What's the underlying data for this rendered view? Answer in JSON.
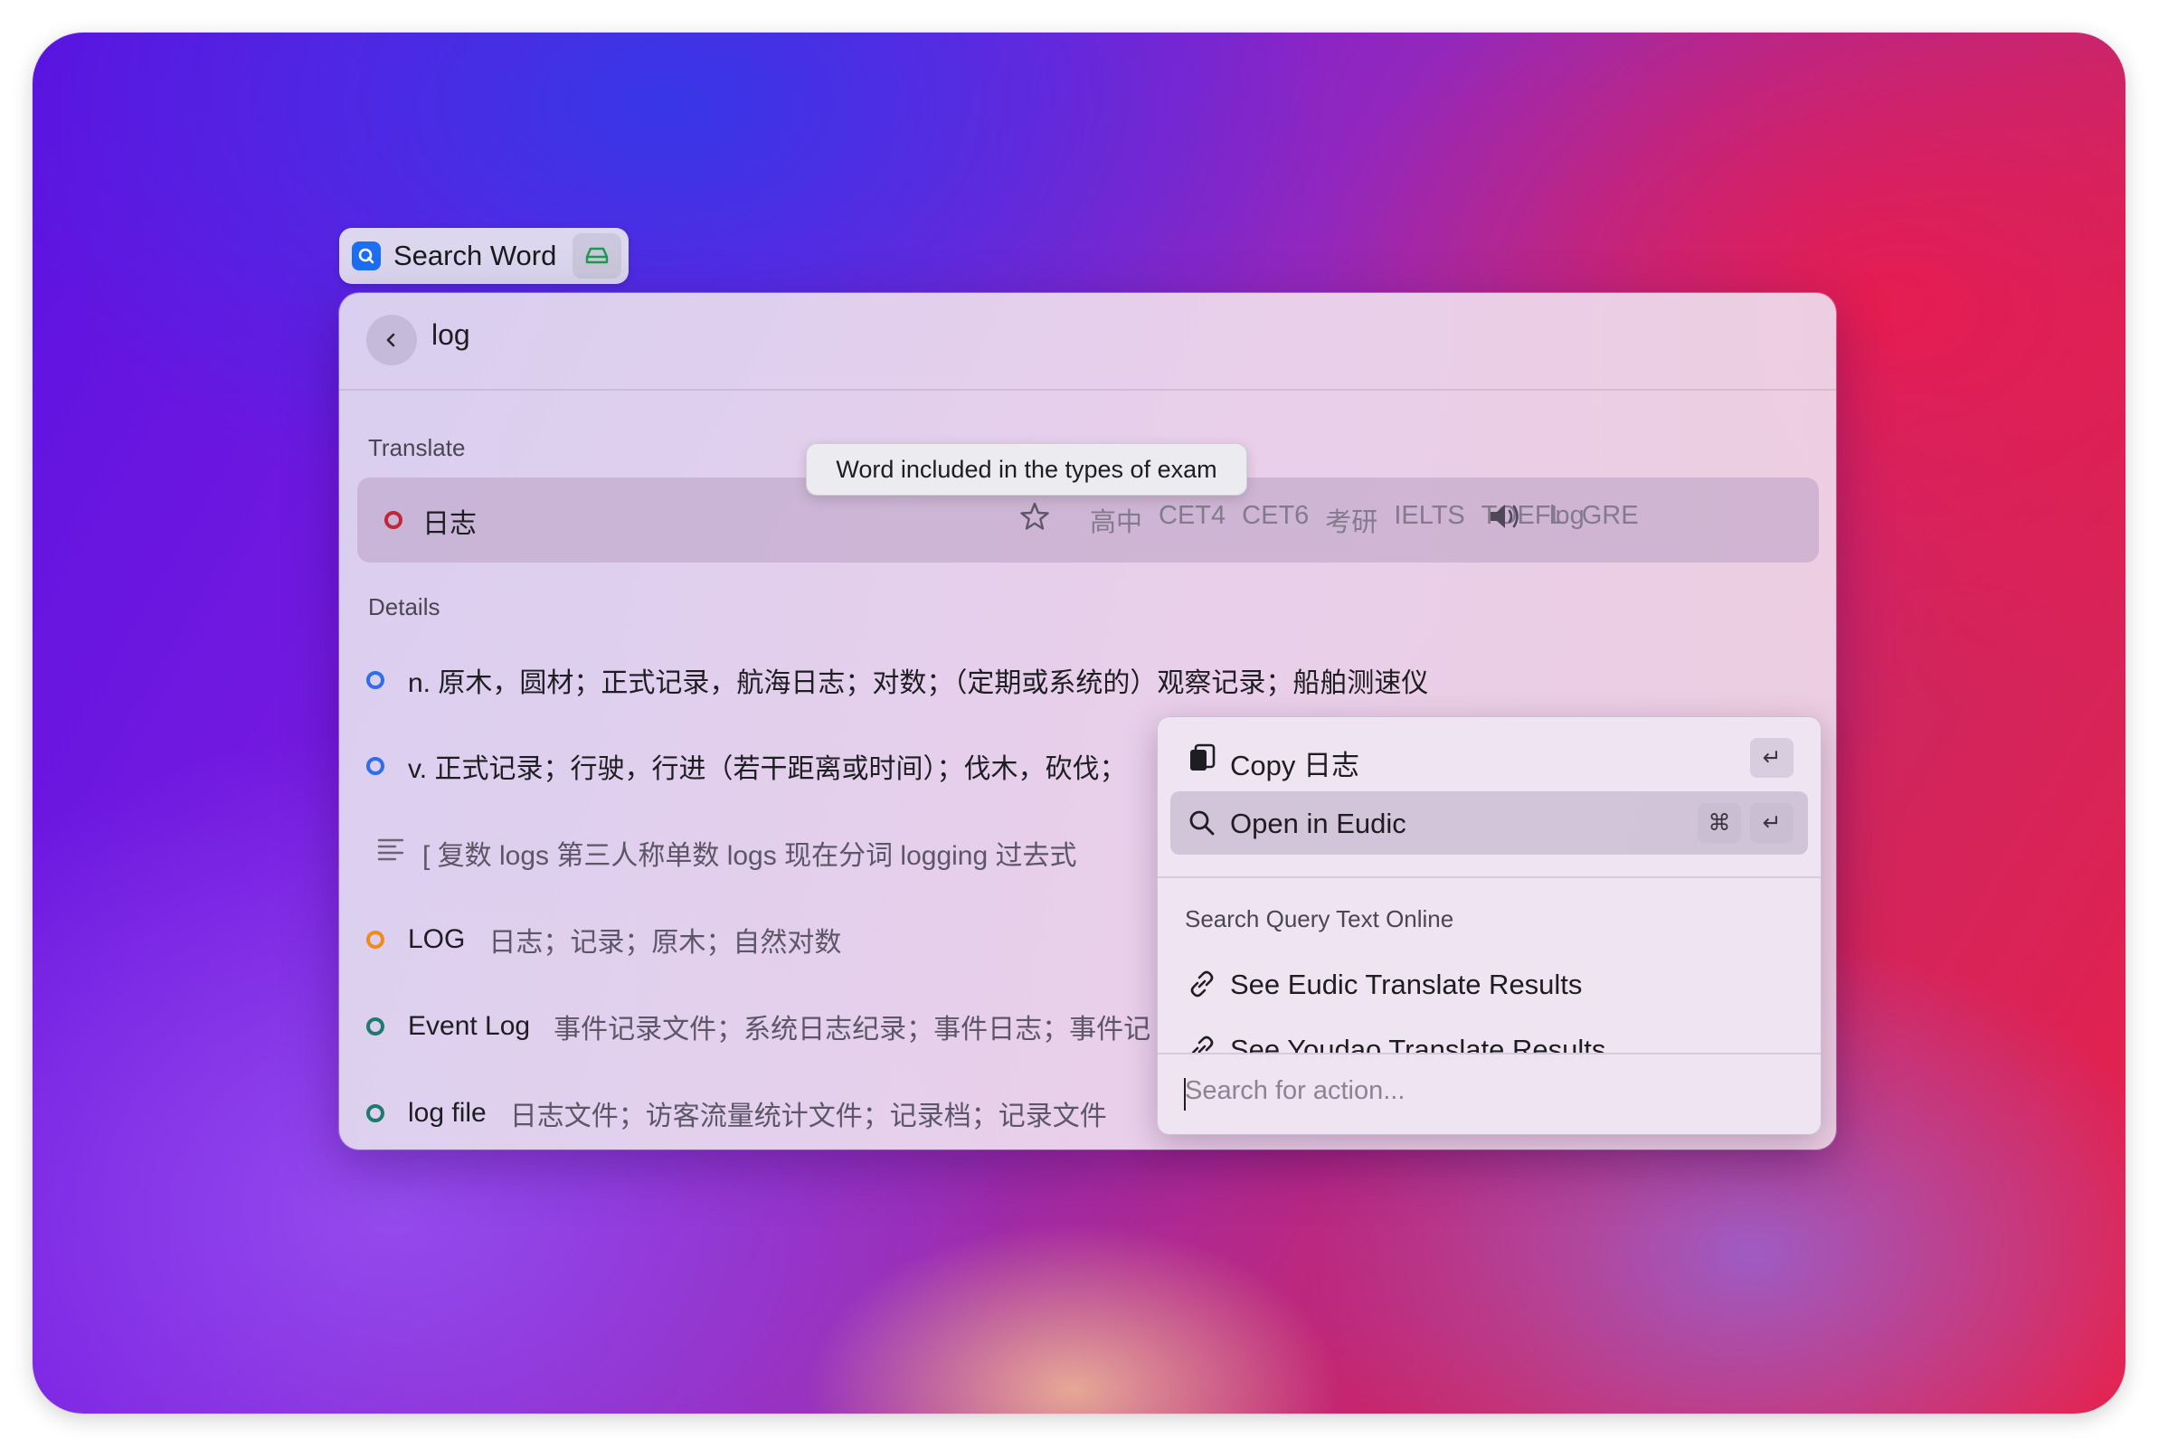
{
  "window": {
    "title": "Search Word"
  },
  "search": {
    "query": "log"
  },
  "translate": {
    "section_title": "Translate",
    "result": "日志",
    "exam_tags": [
      "高中",
      "CET4",
      "CET6",
      "考研",
      "IELTS",
      "TOEFL",
      "GRE"
    ],
    "phonetic": "lɒg",
    "tooltip": "Word included in the types of exam"
  },
  "details": {
    "section_title": "Details",
    "rows": [
      {
        "title": "n. 原木，圆材；正式记录，航海日志；对数；（定期或系统的）观察记录；船舶测速仪",
        "subtitle": "",
        "dot_color": "#2f6ee8"
      },
      {
        "title": "v. 正式记录；行驶，行进（若干距离或时间）；伐木，砍伐；",
        "subtitle": "",
        "dot_color": "#2f6ee8"
      },
      {
        "title": "[ 复数 logs   第三人称单数 logs   现在分词 logging   过去式",
        "subtitle": "",
        "dot_color": ""
      },
      {
        "title": "LOG",
        "subtitle": "日志；记录；原木；自然对数",
        "dot_color": "#f08a1a"
      },
      {
        "title": "Event Log",
        "subtitle": "事件记录文件；系统日志纪录；事件日志；事件记",
        "dot_color": "#1e7a6e"
      },
      {
        "title": "log file",
        "subtitle": "日志文件；访客流量统计文件；记录档；记录文件",
        "dot_color": "#1e7a6e"
      }
    ]
  },
  "action_panel": {
    "items": [
      {
        "label": "Copy  日志",
        "shortcut": [
          "↵"
        ]
      },
      {
        "label": "Open in Eudic",
        "shortcut": [
          "⌘",
          "↵"
        ]
      }
    ],
    "section_title": "Search Query Text Online",
    "online_items": [
      {
        "label": "See Eudic Translate Results"
      },
      {
        "label": "See Youdao Translate Results"
      }
    ],
    "search_placeholder": "Search for action..."
  },
  "colors": {
    "translate_dot": "#c0283a",
    "accent_blue": "#1c6ef2"
  }
}
